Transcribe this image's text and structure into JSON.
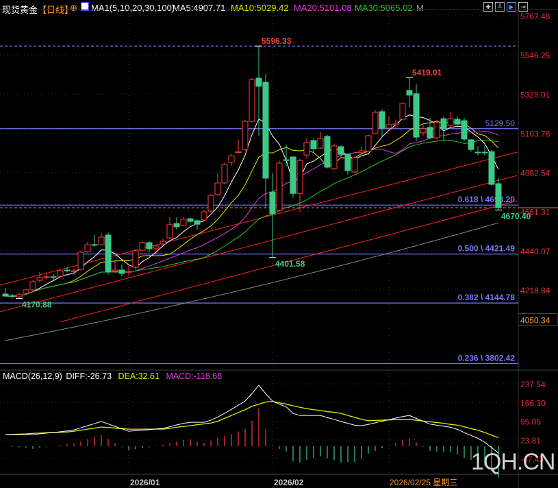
{
  "header": {
    "title": "现货黄金",
    "period": "【日线】",
    "ma_label": "MA1(5,10,20,30,100)",
    "ma5": "MA5:4907.71",
    "ma10": "MA10:5029.42",
    "ma20": "MA20:5101.08",
    "ma30": "MA30:5065.02",
    "ma_more": "M",
    "toolbar_icons": [
      "crosshair-icon",
      "bar-style-icon",
      "play-icon",
      "exit-icon"
    ]
  },
  "colors": {
    "up": "#ff3b3b",
    "down": "#3cc987",
    "ma5": "#ffffff",
    "ma10": "#e8e800",
    "ma20": "#e040e0",
    "ma30": "#22cc22",
    "ma100": "#888888",
    "fib": "#7777ff",
    "trend": "#ff2020",
    "axis_text": "#e0303a",
    "cursor": "#ff9a2a"
  },
  "chart_data": [
    {
      "type": "candlestick",
      "title": "现货黄金 【日线】",
      "y_ticks": [
        5767.48,
        5546.25,
        5325.01,
        5103.78,
        4882.54,
        4661.31,
        4440.07,
        4218.84
      ],
      "cursor_price": "4050.34",
      "x_labels": [
        {
          "bar": 18,
          "label": "2026/01"
        },
        {
          "bar": 39,
          "label": "2026/02"
        }
      ],
      "cursor_date": {
        "bar": 56,
        "label": "2026/02/25 星期三"
      },
      "ohlc": [
        [
          4196,
          4230,
          4178,
          4184
        ],
        [
          4186,
          4196,
          4170,
          4182
        ],
        [
          4180,
          4205,
          4170.88,
          4192
        ],
        [
          4200,
          4225,
          4188,
          4219
        ],
        [
          4219,
          4275,
          4212,
          4265
        ],
        [
          4273,
          4320,
          4260,
          4289
        ],
        [
          4290,
          4318,
          4278,
          4293
        ],
        [
          4293,
          4310,
          4275,
          4292
        ],
        [
          4296,
          4333,
          4290,
          4327
        ],
        [
          4331,
          4350,
          4318,
          4327
        ],
        [
          4325,
          4340,
          4305,
          4327
        ],
        [
          4335,
          4440,
          4330,
          4432
        ],
        [
          4436,
          4490,
          4428,
          4474
        ],
        [
          4475,
          4530,
          4460,
          4474
        ],
        [
          4474,
          4540,
          4470,
          4517
        ],
        [
          4529,
          4545,
          4305,
          4320
        ],
        [
          4325,
          4390,
          4315,
          4331
        ],
        [
          4331,
          4360,
          4296,
          4312
        ],
        [
          4320,
          4355,
          4300,
          4322
        ],
        [
          4347,
          4450,
          4330,
          4440
        ],
        [
          4443,
          4495,
          4438,
          4486
        ],
        [
          4486,
          4495,
          4430,
          4451
        ],
        [
          4455,
          4470,
          4420,
          4467
        ],
        [
          4478,
          4510,
          4470,
          4494
        ],
        [
          4513,
          4630,
          4505,
          4587
        ],
        [
          4594,
          4630,
          4560,
          4575
        ],
        [
          4583,
          4630,
          4580,
          4618
        ],
        [
          4621,
          4625,
          4595,
          4606
        ],
        [
          4610,
          4615,
          4560,
          4590
        ],
        [
          4614,
          4670,
          4608,
          4660
        ],
        [
          4664,
          4760,
          4655,
          4753
        ],
        [
          4757,
          4880,
          4748,
          4823
        ],
        [
          4823,
          4940,
          4815,
          4927
        ],
        [
          4939,
          4985,
          4920,
          4977
        ],
        [
          4995,
          5070,
          4990,
          4999
        ],
        [
          5012,
          5180,
          5005,
          5171
        ],
        [
          5171,
          5415,
          5165,
          5407
        ],
        [
          5415,
          5596.33,
          5090,
          5369
        ],
        [
          5392,
          5440,
          4680,
          4850
        ],
        [
          4772,
          4880,
          4401.58,
          4649
        ],
        [
          4668,
          4950,
          4660,
          4935
        ],
        [
          4954,
          5040,
          4920,
          4952
        ],
        [
          4970,
          4975,
          4740,
          4764
        ],
        [
          4764,
          4960,
          4660,
          4950
        ],
        [
          4981,
          5075,
          4960,
          5051
        ],
        [
          5063,
          5075,
          4995,
          5016
        ],
        [
          5020,
          5110,
          5015,
          5074
        ],
        [
          5086,
          5095,
          4905,
          4912
        ],
        [
          4904,
          5045,
          4895,
          5032
        ],
        [
          5028,
          5035,
          4970,
          4985
        ],
        [
          4985,
          4990,
          4870,
          4893
        ],
        [
          4885,
          4975,
          4880,
          4966
        ],
        [
          4994,
          5030,
          4985,
          5005
        ],
        [
          5001,
          5095,
          4995,
          5090
        ],
        [
          5102,
          5235,
          5100,
          5222
        ],
        [
          5226,
          5240,
          5080,
          5133
        ],
        [
          5133,
          5200,
          5125,
          5152
        ],
        [
          5152,
          5180,
          5130,
          5160
        ],
        [
          5183,
          5280,
          5175,
          5272
        ],
        [
          5346,
          5419.01,
          5250,
          5319
        ],
        [
          5327,
          5380,
          5060,
          5082
        ],
        [
          5106,
          5150,
          5090,
          5129
        ],
        [
          5137,
          5190,
          5070,
          5078
        ],
        [
          5078,
          5180,
          5068,
          5164
        ],
        [
          5186,
          5200,
          5060,
          5129
        ],
        [
          5148,
          5225,
          5140,
          5186
        ],
        [
          5183,
          5200,
          5140,
          5155
        ],
        [
          5175,
          5190,
          5060,
          5071
        ],
        [
          5067,
          5070,
          5000,
          5012
        ],
        [
          4997,
          5030,
          4980,
          4994
        ],
        [
          4997,
          5030,
          4980,
          4994
        ],
        [
          5000,
          5010,
          4808,
          4815
        ],
        [
          4819,
          4850,
          4670.4,
          4683
        ]
      ],
      "ma_periods": [
        5,
        10,
        20,
        30
      ],
      "ma100_endpoints": [
        3933,
        4598
      ],
      "annotations": [
        {
          "label": "5596.33",
          "price": 5596.33,
          "bar": 37,
          "kind": "high"
        },
        {
          "label": "5419.01",
          "price": 5419.01,
          "bar": 59,
          "kind": "high"
        },
        {
          "label": "4401.58",
          "price": 4401.58,
          "bar": 39,
          "kind": "low"
        },
        {
          "label": "4170.88",
          "price": 4170.88,
          "bar": 2,
          "kind": "low"
        },
        {
          "label": "4670.40",
          "price": 4670.4,
          "bar": 72,
          "kind": "low"
        }
      ],
      "horizontal_lines": [
        {
          "label": "",
          "price": 5596.33,
          "style": "dashed"
        },
        {
          "label": "5129.50",
          "price": 5129.5,
          "style": "solid"
        },
        {
          "label": "0.618 \\ 4698.20",
          "price": 4698.2,
          "style": "solid"
        },
        {
          "label": "0.500 \\ 4421.49",
          "price": 4421.49,
          "style": "solid"
        },
        {
          "label": "0.382 \\ 4144.78",
          "price": 4144.78,
          "style": "solid"
        },
        {
          "label": "0.236 \\ 3802.42",
          "price": 3802.42,
          "style": "solid"
        }
      ],
      "last_price_line": 4683,
      "trendlines": [
        {
          "from_bar": 0,
          "from_price": 4246,
          "to_bar": 74.7,
          "to_price": 4997
        },
        {
          "from_bar": 0,
          "from_price": 4095,
          "to_bar": 74.7,
          "to_price": 4865
        },
        {
          "from_bar": 8.7,
          "from_price": 4037,
          "to_bar": 74.7,
          "to_price": 4722
        }
      ]
    },
    {
      "type": "macd",
      "title": "MACD(26,12,9)",
      "diff_label": "DIFF:-26.73",
      "dea_label": "DEA:32.61",
      "macd_label": "MACD:-118.68",
      "y_ticks": [
        237.54,
        166.3,
        95.05,
        23.81,
        -47.43
      ],
      "diff": [
        44,
        44,
        44,
        44,
        44,
        47,
        50,
        52,
        55,
        58,
        62,
        70,
        78,
        86,
        94,
        85,
        75,
        66,
        57,
        59,
        61,
        63,
        66,
        68,
        74,
        81,
        87,
        91,
        91,
        91,
        99,
        111,
        125,
        140,
        156,
        172,
        200,
        232,
        200,
        172,
        160,
        150,
        125,
        117,
        117,
        117,
        117,
        109,
        102,
        94,
        87,
        80,
        78,
        83,
        89,
        95,
        101,
        107,
        113,
        117,
        106,
        95,
        84,
        80,
        76,
        72,
        64,
        52,
        41,
        30,
        15,
        -5,
        -26.73
      ],
      "dea": [
        44,
        45,
        46,
        47,
        49,
        50,
        51,
        52,
        53,
        54,
        57,
        61,
        65,
        69,
        73,
        71,
        69,
        67,
        65,
        65,
        65,
        65,
        65,
        65,
        68,
        72,
        75,
        78,
        82,
        85,
        88,
        95,
        106,
        117,
        128,
        139,
        152,
        160,
        168,
        171,
        165,
        160,
        154,
        148,
        143,
        139,
        136,
        132,
        129,
        125,
        117,
        110,
        102,
        97,
        98,
        99,
        100,
        101,
        101,
        102,
        99,
        96,
        93,
        90,
        87,
        83,
        80,
        74,
        67,
        61,
        52,
        42,
        32.61
      ]
    }
  ],
  "watermark": "1QH.CN"
}
